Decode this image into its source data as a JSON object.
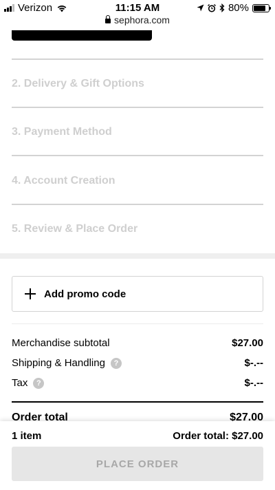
{
  "status_bar": {
    "carrier": "Verizon",
    "time": "11:15 AM",
    "url": "sephora.com",
    "battery": "80%",
    "battery_level": 0.8,
    "icons": [
      "signal-icon",
      "wifi-icon",
      "lock-icon",
      "location-arrow-icon",
      "alarm-icon",
      "bluetooth-icon",
      "battery-icon"
    ]
  },
  "checkout_steps": [
    {
      "label": "2. Delivery & Gift Options"
    },
    {
      "label": "3. Payment Method"
    },
    {
      "label": "4. Account Creation"
    },
    {
      "label": "5. Review & Place Order"
    }
  ],
  "promo": {
    "label": "Add promo code",
    "icon": "plus-icon"
  },
  "summary": {
    "merchandise_label": "Merchandise subtotal",
    "merchandise_value": "$27.00",
    "shipping_label": "Shipping & Handling",
    "shipping_value": "$-.--",
    "tax_label": "Tax",
    "tax_value": "$-.--",
    "help_icon_glyph": "?",
    "order_total_label": "Order total",
    "order_total_value": "$27.00"
  },
  "bottom_bar": {
    "item_count": "1 item",
    "order_total": "Order total: $27.00",
    "place_order_label": "PLACE ORDER"
  },
  "colors": {
    "disabled_text": "#cfcfcf",
    "button_disabled_bg": "#e6e6e6",
    "button_disabled_text": "#a8a8a8",
    "separator": "#d3d3d3",
    "help_icon_bg": "#c6c6c6"
  }
}
